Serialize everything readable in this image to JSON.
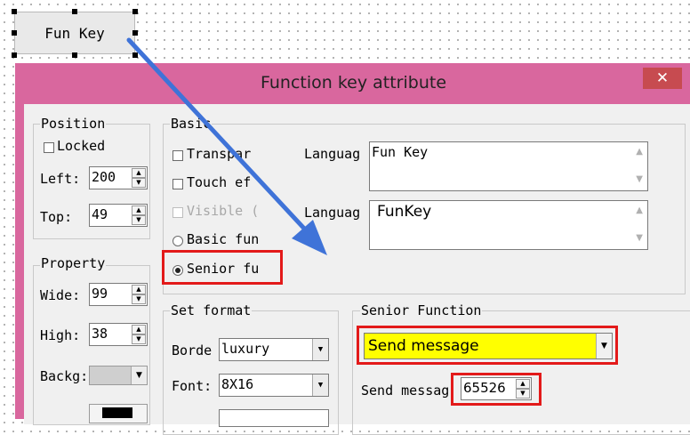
{
  "widget": {
    "label": "Fun Key"
  },
  "dialog": {
    "title": "Function key attribute",
    "close_glyph": "✕",
    "position": {
      "label": "Position",
      "locked_label": "Locked",
      "left_label": "Left:",
      "left_value": "200",
      "top_label": "Top:",
      "top_value": "49"
    },
    "property": {
      "label": "Property",
      "wide_label": "Wide:",
      "wide_value": "99",
      "high_label": "High:",
      "high_value": "38",
      "backg_label": "Backg:"
    },
    "basic": {
      "label": "Basic",
      "transpar_label": "Transpar",
      "touch_label": "Touch ef",
      "visible_label": "Visible (",
      "basic_fun_label": "Basic fun",
      "senior_fu_label": "Senior fu",
      "language1_label": "Languag",
      "language1_value": "Fun Key",
      "language2_label": "Languag",
      "language2_value": "FunKey"
    },
    "set_format": {
      "label": "Set format",
      "border_label": "Borde",
      "border_value": "luxury",
      "font_label": "Font:",
      "font_value": "8X16"
    },
    "senior_function": {
      "label": "Senior Function",
      "function_value": "Send message",
      "send_message_label": "Send messag",
      "send_message_value": "65526"
    }
  },
  "colors": {
    "dialog_frame": "#d9679e",
    "close_button": "#c74b50",
    "highlight": "#ffff00",
    "annotation_red": "#e31a1a",
    "arrow_blue": "#3f73d8"
  }
}
